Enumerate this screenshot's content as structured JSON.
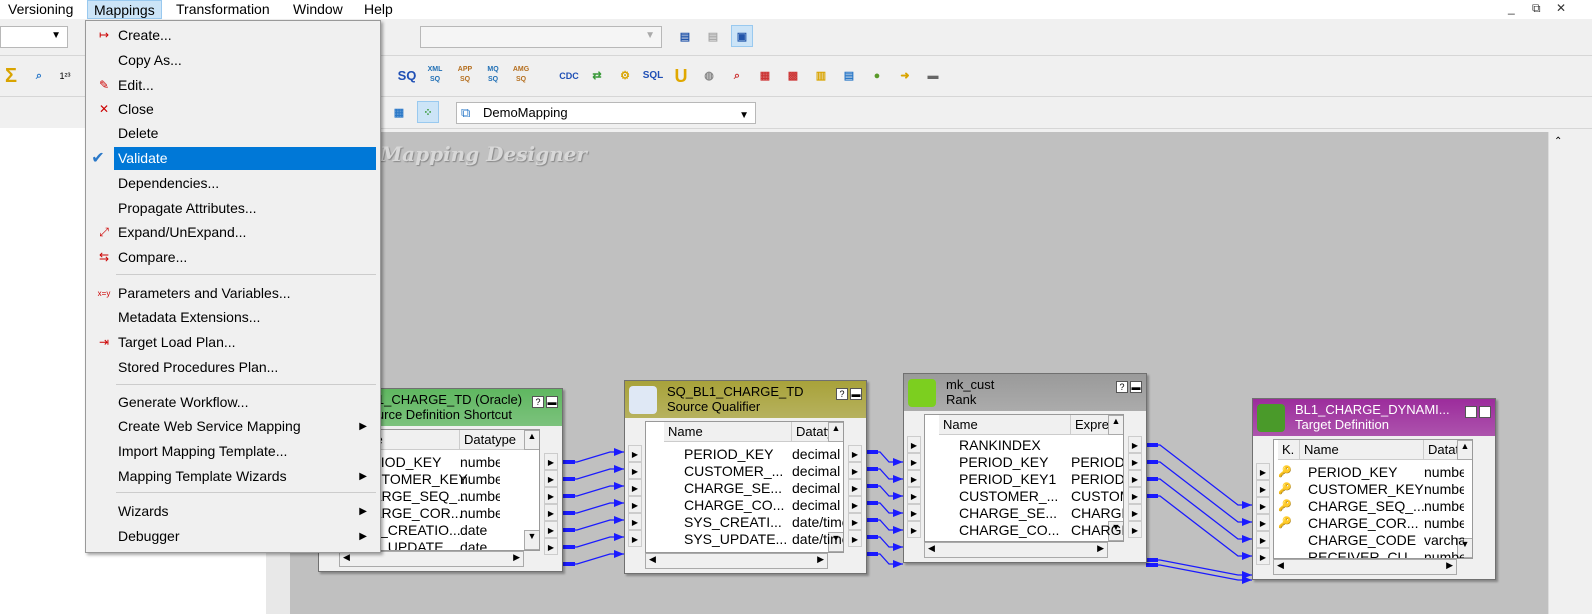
{
  "menubar": {
    "items": [
      "Versioning",
      "Mappings",
      "Transformation",
      "Window",
      "Help"
    ],
    "active": "Mappings"
  },
  "window_controls": [
    "_",
    "⧉",
    "✕"
  ],
  "toolbar": {
    "mapping_select": "DemoMapping",
    "sq_icons": [
      "SQ",
      "XML SQ",
      "APP SQ",
      "MQ SQ",
      "AMG SQ"
    ],
    "cdc_label": "CDC",
    "sql_label": "SQL"
  },
  "canvas": {
    "watermark": "Mapping Designer"
  },
  "mappings_menu": {
    "items": [
      {
        "label": "Create...",
        "icon": "create-icon"
      },
      {
        "label": "Copy As..."
      },
      {
        "label": "Edit...",
        "icon": "edit-icon"
      },
      {
        "label": "Close",
        "icon": "close-mapping-icon"
      },
      {
        "label": "Delete"
      },
      {
        "label": "Validate",
        "icon": "checkmark-icon",
        "highlighted": true
      },
      {
        "label": "Dependencies..."
      },
      {
        "label": "Propagate Attributes..."
      },
      {
        "label": "Expand/UnExpand...",
        "icon": "expand-icon"
      },
      {
        "label": "Compare...",
        "icon": "compare-icon"
      },
      {
        "label": "Parameters and Variables...",
        "icon": "parameters-icon"
      },
      {
        "label": "Metadata Extensions..."
      },
      {
        "label": "Target Load Plan...",
        "icon": "target-load-icon"
      },
      {
        "label": "Stored Procedures Plan..."
      },
      {
        "label": "Generate Workflow..."
      },
      {
        "label": "Create Web Service Mapping",
        "submenu": true
      },
      {
        "label": "Import Mapping Template..."
      },
      {
        "label": "Mapping Template Wizards",
        "submenu": true
      },
      {
        "label": "Wizards",
        "submenu": true
      },
      {
        "label": "Debugger",
        "submenu": true
      }
    ]
  },
  "transformations": [
    {
      "title": "BL1_CHARGE_TD (Oracle)",
      "type": "Source Definition Shortcut",
      "color": "#5fb760",
      "columns": [
        "Name",
        "Datatype"
      ],
      "rows": [
        [
          "PERIOD_KEY",
          "number"
        ],
        [
          "CUSTOMER_KEY",
          "number"
        ],
        [
          "CHARGE_SEQ_...",
          "number"
        ],
        [
          "CHARGE_COR...",
          "number"
        ],
        [
          "SYS_CREATIO...",
          "date"
        ],
        [
          "SYS_UPDATE...",
          "date"
        ]
      ]
    },
    {
      "title": "SQ_BL1_CHARGE_TD",
      "type": "Source Qualifier",
      "color": "#a8a23a",
      "columns": [
        "Name",
        "Datatype"
      ],
      "rows": [
        [
          "PERIOD_KEY",
          "decimal"
        ],
        [
          "CUSTOMER_...",
          "decimal"
        ],
        [
          "CHARGE_SE...",
          "decimal"
        ],
        [
          "CHARGE_CO...",
          "decimal"
        ],
        [
          "SYS_CREATI...",
          "date/time"
        ],
        [
          "SYS_UPDATE...",
          "date/time"
        ]
      ]
    },
    {
      "title": "mk_cust",
      "type": "Rank",
      "color": "#9a9a9a",
      "columns": [
        "Name",
        "Expression"
      ],
      "rows": [
        [
          "RANKINDEX",
          ""
        ],
        [
          "PERIOD_KEY",
          "PERIOD_"
        ],
        [
          "PERIOD_KEY1",
          "PERIOD_"
        ],
        [
          "CUSTOMER_...",
          "CUSTOM"
        ],
        [
          "CHARGE_SE...",
          "CHARGE"
        ],
        [
          "CHARGE_CO...",
          "CHARGE"
        ]
      ]
    },
    {
      "title": "BL1_CHARGE_DYNAMI...",
      "type": "Target Definition",
      "color": "#9c2c9c",
      "columns": [
        "K.",
        "Name",
        "Datatype"
      ],
      "rows": [
        [
          "key",
          "PERIOD_KEY",
          "number"
        ],
        [
          "key",
          "CUSTOMER_KEY",
          "number"
        ],
        [
          "key",
          "CHARGE_SEQ_...",
          "number"
        ],
        [
          "key",
          "CHARGE_COR...",
          "number"
        ],
        [
          "",
          "CHARGE_CODE",
          "varchar"
        ],
        [
          "",
          "RECEIVER_CU...",
          "number"
        ]
      ]
    }
  ],
  "colors": {
    "link": "#1a1aff",
    "menu_highlight": "#0078d7",
    "canvas": "#c0c0c0"
  }
}
